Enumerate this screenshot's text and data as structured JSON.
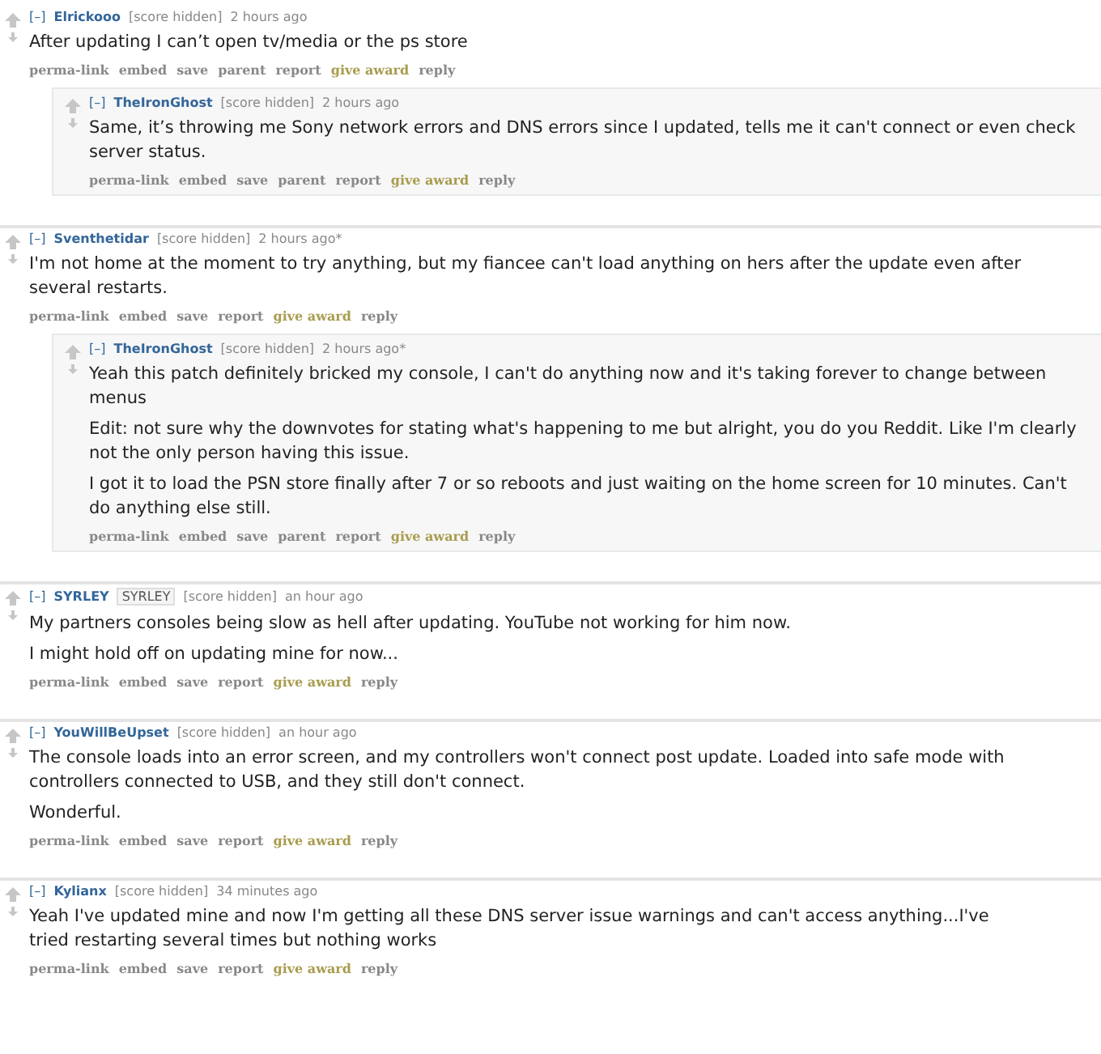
{
  "comments": [
    {
      "author": "Elrickooo",
      "score": "[score hidden]",
      "time": "2 hours ago",
      "collapse": "[–]",
      "paragraphs": [
        "After updating I can’t open tv/media or the ps store"
      ],
      "actions": [
        {
          "label": "perma-link",
          "kind": "link"
        },
        {
          "label": "embed",
          "kind": "link"
        },
        {
          "label": "save",
          "kind": "link"
        },
        {
          "label": "parent",
          "kind": "link"
        },
        {
          "label": "report",
          "kind": "link"
        },
        {
          "label": "give award",
          "kind": "award"
        },
        {
          "label": "reply",
          "kind": "link"
        }
      ],
      "children": [
        {
          "author": "TheIronGhost",
          "score": "[score hidden]",
          "time": "2 hours ago",
          "collapse": "[–]",
          "paragraphs": [
            "Same, it’s throwing me Sony network errors and DNS errors since I updated, tells me it can't connect or even check server status."
          ],
          "actions": [
            {
              "label": "perma-link",
              "kind": "link"
            },
            {
              "label": "embed",
              "kind": "link"
            },
            {
              "label": "save",
              "kind": "link"
            },
            {
              "label": "parent",
              "kind": "link"
            },
            {
              "label": "report",
              "kind": "link"
            },
            {
              "label": "give award",
              "kind": "award"
            },
            {
              "label": "reply",
              "kind": "link"
            }
          ]
        }
      ]
    },
    {
      "author": "Sventhetidar",
      "score": "[score hidden]",
      "time": "2 hours ago*",
      "collapse": "[–]",
      "paragraphs": [
        "I'm not home at the moment to try anything, but my fiancee can't load anything on hers after the update even after several restarts."
      ],
      "actions": [
        {
          "label": "perma-link",
          "kind": "link"
        },
        {
          "label": "embed",
          "kind": "link"
        },
        {
          "label": "save",
          "kind": "link"
        },
        {
          "label": "report",
          "kind": "link"
        },
        {
          "label": "give award",
          "kind": "award"
        },
        {
          "label": "reply",
          "kind": "link"
        }
      ],
      "children": [
        {
          "author": "TheIronGhost",
          "score": "[score hidden]",
          "time": "2 hours ago*",
          "collapse": "[–]",
          "paragraphs": [
            "Yeah this patch definitely bricked my console, I can't do anything now and it's taking forever to change between menus",
            "Edit: not sure why the downvotes for stating what's happening to me but alright, you do you Reddit. Like I'm clearly not the only person having this issue.",
            "I got it to load the PSN store finally after 7 or so reboots and just waiting on the home screen for 10 minutes. Can't do anything else still."
          ],
          "actions": [
            {
              "label": "perma-link",
              "kind": "link"
            },
            {
              "label": "embed",
              "kind": "link"
            },
            {
              "label": "save",
              "kind": "link"
            },
            {
              "label": "parent",
              "kind": "link"
            },
            {
              "label": "report",
              "kind": "link"
            },
            {
              "label": "give award",
              "kind": "award"
            },
            {
              "label": "reply",
              "kind": "link"
            }
          ]
        }
      ]
    },
    {
      "author": "SYRLEY",
      "flair": "SYRLEY",
      "score": "[score hidden]",
      "time": "an hour ago",
      "collapse": "[–]",
      "paragraphs": [
        "My partners consoles being slow as hell after updating. YouTube not working for him now.",
        "I might hold off on updating mine for now..."
      ],
      "actions": [
        {
          "label": "perma-link",
          "kind": "link"
        },
        {
          "label": "embed",
          "kind": "link"
        },
        {
          "label": "save",
          "kind": "link"
        },
        {
          "label": "report",
          "kind": "link"
        },
        {
          "label": "give award",
          "kind": "award"
        },
        {
          "label": "reply",
          "kind": "link"
        }
      ]
    },
    {
      "author": "YouWillBeUpset",
      "score": "[score hidden]",
      "time": "an hour ago",
      "collapse": "[–]",
      "paragraphs": [
        "The console loads into an error screen, and my controllers won't connect post update. Loaded into safe mode with controllers connected to USB, and they still don't connect.",
        "Wonderful."
      ],
      "actions": [
        {
          "label": "perma-link",
          "kind": "link"
        },
        {
          "label": "embed",
          "kind": "link"
        },
        {
          "label": "save",
          "kind": "link"
        },
        {
          "label": "report",
          "kind": "link"
        },
        {
          "label": "give award",
          "kind": "award"
        },
        {
          "label": "reply",
          "kind": "link"
        }
      ]
    },
    {
      "author": "Kylianx",
      "score": "[score hidden]",
      "time": "34 minutes ago",
      "collapse": "[–]",
      "paragraphs": [
        "Yeah I've updated mine and now I'm getting all these DNS server issue warnings and can't access anything...I've tried restarting several times but nothing works"
      ],
      "actions": [
        {
          "label": "perma-link",
          "kind": "link"
        },
        {
          "label": "embed",
          "kind": "link"
        },
        {
          "label": "save",
          "kind": "link"
        },
        {
          "label": "report",
          "kind": "link"
        },
        {
          "label": "give award",
          "kind": "award"
        },
        {
          "label": "reply",
          "kind": "link"
        }
      ]
    }
  ]
}
